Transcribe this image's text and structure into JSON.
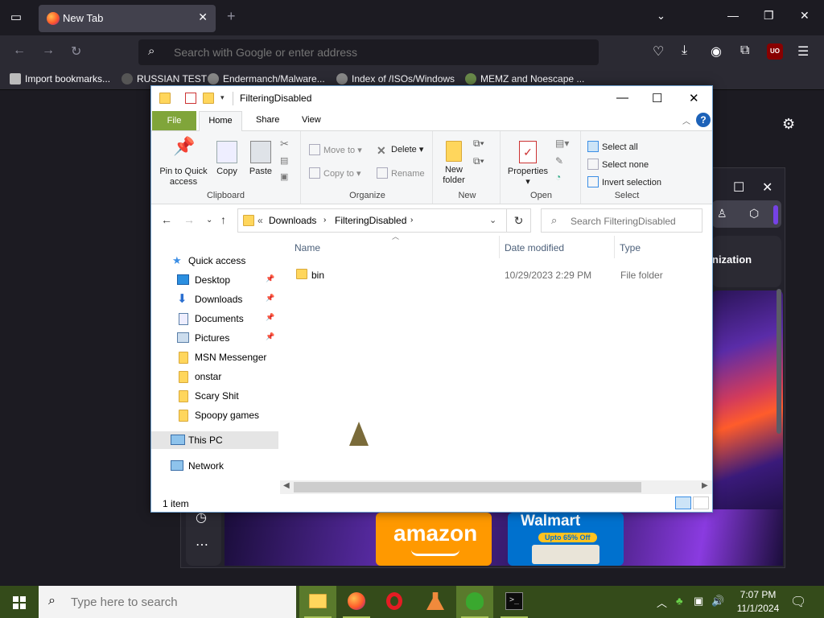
{
  "browser": {
    "tab_title": "New Tab",
    "search_placeholder": "Search with Google or enter address",
    "ublock_badge": "UO",
    "bookmarks": [
      {
        "label": "Import bookmarks..."
      },
      {
        "label": "RUSSIAN TEST"
      },
      {
        "label": "Endermanch/Malware..."
      },
      {
        "label": "Index of /ISOs/Windows"
      },
      {
        "label": "MEMZ and Noescape ..."
      }
    ],
    "panel_card_text": "nization",
    "ads": {
      "amazon": "amazon",
      "walmart": "Walmart",
      "walmart_badge": "Upto 65% Off"
    }
  },
  "explorer": {
    "title": "FilteringDisabled",
    "ribbon_tabs": {
      "file": "File",
      "home": "Home",
      "share": "Share",
      "view": "View"
    },
    "clipboard": {
      "pin": "Pin to Quick access",
      "copy": "Copy",
      "paste": "Paste",
      "label": "Clipboard"
    },
    "organize": {
      "move_to": "Move to",
      "copy_to": "Copy to",
      "delete": "Delete",
      "rename": "Rename",
      "label": "Organize"
    },
    "new": {
      "new_folder": "New folder",
      "label": "New"
    },
    "open": {
      "properties": "Properties",
      "label": "Open"
    },
    "select": {
      "select_all": "Select all",
      "select_none": "Select none",
      "invert": "Invert selection",
      "label": "Select"
    },
    "address": {
      "prefix": "«",
      "crumbs": [
        "Downloads",
        "FilteringDisabled"
      ],
      "search_placeholder": "Search FilteringDisabled"
    },
    "nav": {
      "quick_access": "Quick access",
      "items": [
        {
          "label": "Desktop",
          "pinned": true
        },
        {
          "label": "Downloads",
          "pinned": true
        },
        {
          "label": "Documents",
          "pinned": true
        },
        {
          "label": "Pictures",
          "pinned": true
        },
        {
          "label": "MSN Messenger",
          "pinned": false
        },
        {
          "label": "onstar",
          "pinned": false
        },
        {
          "label": "Scary Shit",
          "pinned": false
        },
        {
          "label": "Spoopy games",
          "pinned": false
        }
      ],
      "this_pc": "This PC",
      "network": "Network"
    },
    "columns": {
      "name": "Name",
      "date": "Date modified",
      "type": "Type"
    },
    "rows": [
      {
        "name": "bin",
        "date": "10/29/2023 2:29 PM",
        "type": "File folder"
      }
    ],
    "status": "1 item"
  },
  "taskbar": {
    "search_placeholder": "Type here to search",
    "time": "7:07 PM",
    "date": "11/1/2024"
  },
  "colors": {
    "taskbar": "#344b1a",
    "file_tab": "#80a53a",
    "accent": "#1d62b8"
  }
}
